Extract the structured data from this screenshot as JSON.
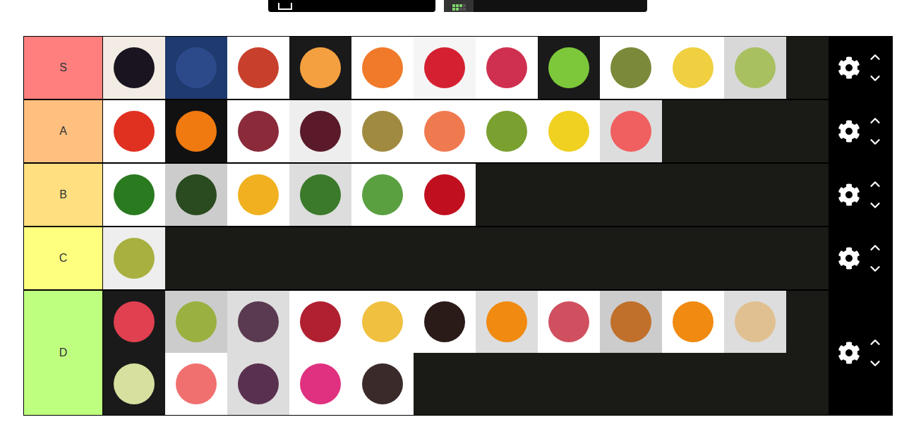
{
  "tiers": [
    {
      "label": "S",
      "color": "#ff7f7f",
      "items": [
        {
          "color": "#1a1420",
          "background": "#f2ece4"
        },
        {
          "color": "#2c4a8a",
          "background": "#1e3a6e"
        },
        {
          "color": "#c8402c",
          "background": "#ffffff"
        },
        {
          "color": "#f5a040",
          "background": "#1a1a1a"
        },
        {
          "color": "#f07a2a",
          "background": "#ffffff"
        },
        {
          "color": "#d42030",
          "background": "#f5f5f5"
        },
        {
          "color": "#d03050",
          "background": "#ffffff"
        },
        {
          "color": "#7cc83a",
          "background": "#1a1a1a"
        },
        {
          "color": "#7a8a3a",
          "background": "#ffffff"
        },
        {
          "color": "#f0d040",
          "background": "#ffffff"
        },
        {
          "color": "#a8c060",
          "background": "#d8d8d8"
        }
      ]
    },
    {
      "label": "A",
      "color": "#ffbf7f",
      "items": [
        {
          "color": "#e03020",
          "background": "#ffffff"
        },
        {
          "color": "#f07a10",
          "background": "#111111"
        },
        {
          "color": "#8a2a3a",
          "background": "#ffffff"
        },
        {
          "color": "#5a1a2a",
          "background": "#eeeeee"
        },
        {
          "color": "#a08a40",
          "background": "#ffffff"
        },
        {
          "color": "#f07a50",
          "background": "#ffffff"
        },
        {
          "color": "#7aa030",
          "background": "#ffffff"
        },
        {
          "color": "#f0d020",
          "background": "#ffffff"
        },
        {
          "color": "#f06060",
          "background": "#dddddd"
        }
      ]
    },
    {
      "label": "B",
      "color": "#ffdf7f",
      "items": [
        {
          "color": "#2a7a20",
          "background": "#ffffff"
        },
        {
          "color": "#2a4a20",
          "background": "#cccccc"
        },
        {
          "color": "#f0b020",
          "background": "#ffffff"
        },
        {
          "color": "#3a7a2a",
          "background": "#dddddd"
        },
        {
          "color": "#5aa040",
          "background": "#ffffff"
        },
        {
          "color": "#c01020",
          "background": "#ffffff"
        }
      ]
    },
    {
      "label": "C",
      "color": "#ffff7f",
      "items": [
        {
          "color": "#a8b040",
          "background": "#eeeeee"
        }
      ]
    },
    {
      "label": "D",
      "color": "#bfff7f",
      "items": [
        {
          "color": "#e04050",
          "background": "#1a1a1a"
        },
        {
          "color": "#9ab040",
          "background": "#cccccc"
        },
        {
          "color": "#5a3a50",
          "background": "#dddddd"
        },
        {
          "color": "#b02030",
          "background": "#ffffff"
        },
        {
          "color": "#f0c040",
          "background": "#ffffff"
        },
        {
          "color": "#2a1a18",
          "background": "#ffffff"
        },
        {
          "color": "#f08a10",
          "background": "#dddddd"
        },
        {
          "color": "#d05060",
          "background": "#ffffff"
        },
        {
          "color": "#c0702a",
          "background": "#cccccc"
        },
        {
          "color": "#f08a10",
          "background": "#ffffff"
        },
        {
          "color": "#e0c090",
          "background": "#dddddd"
        },
        {
          "color": "#d8e0a0",
          "background": "#1a1a1a"
        },
        {
          "color": "#f07070",
          "background": "#ffffff"
        },
        {
          "color": "#5a3050",
          "background": "#dddddd"
        },
        {
          "color": "#e03080",
          "background": "#ffffff"
        },
        {
          "color": "#3a2a2a",
          "background": "#ffffff"
        }
      ]
    }
  ]
}
